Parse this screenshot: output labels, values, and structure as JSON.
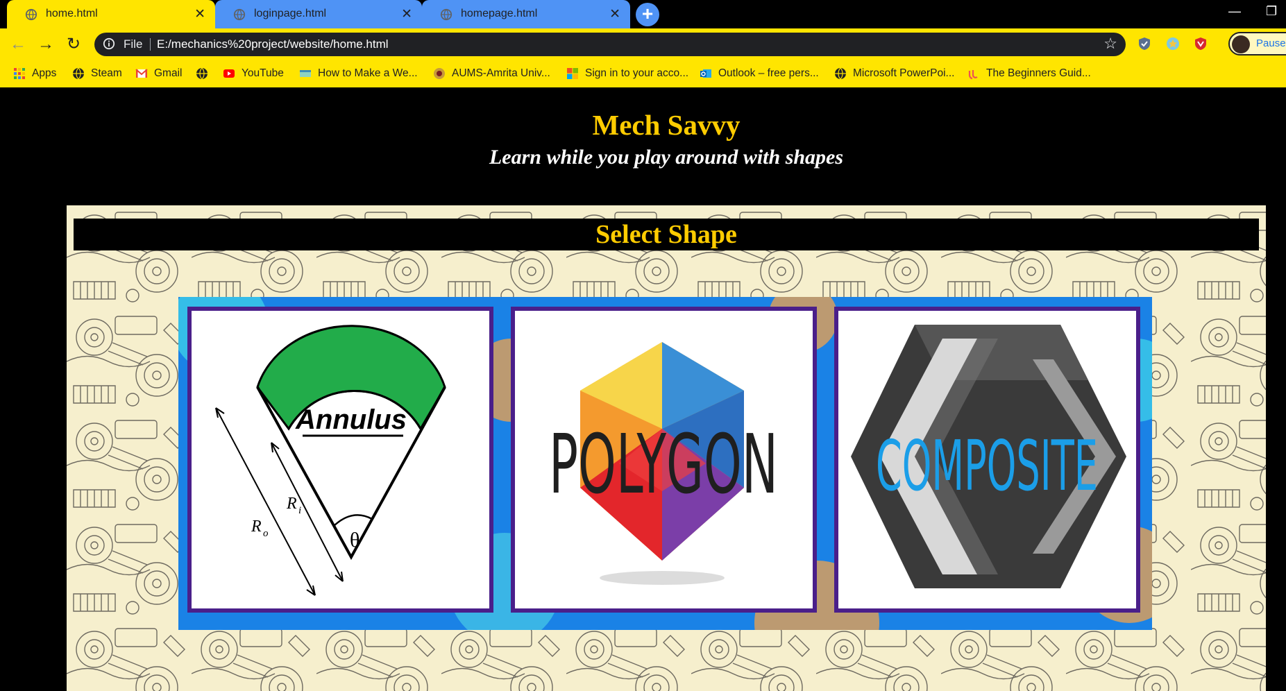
{
  "browser": {
    "tabs": [
      {
        "label": "home.html",
        "active": true
      },
      {
        "label": "loginpage.html",
        "active": false
      },
      {
        "label": "homepage.html",
        "active": false
      }
    ],
    "address": {
      "scheme_label": "File",
      "url": "E:/mechanics%20project/website/home.html"
    },
    "profile_label": "Paused",
    "bookmarks": [
      {
        "label": "Apps",
        "icon": "apps-grid-icon"
      },
      {
        "label": "Steam",
        "icon": "globe-icon"
      },
      {
        "label": "Gmail",
        "icon": "gmail-icon"
      },
      {
        "label": "",
        "icon": "globe-icon"
      },
      {
        "label": "YouTube",
        "icon": "youtube-icon"
      },
      {
        "label": "How to Make a We...",
        "icon": "bookmark-site-icon"
      },
      {
        "label": "AUMS-Amrita Univ...",
        "icon": "amrita-icon"
      },
      {
        "label": "Sign in to your acco...",
        "icon": "microsoft-icon"
      },
      {
        "label": "Outlook – free pers...",
        "icon": "outlook-icon"
      },
      {
        "label": "Microsoft PowerPoi...",
        "icon": "globe-icon"
      },
      {
        "label": "The Beginners Guid...",
        "icon": "udemy-icon"
      }
    ]
  },
  "page": {
    "title": "Mech Savvy",
    "tagline": "Learn while you play around with shapes",
    "section_heading": "Select Shape",
    "shapes": [
      {
        "name": "Annulus",
        "label": "Annulus",
        "dim_outer": "R",
        "dim_outer_sub": "o",
        "dim_inner": "R",
        "dim_inner_sub": "i",
        "angle": "θ"
      },
      {
        "name": "Polygon",
        "label": "POLYGON"
      },
      {
        "name": "Composite",
        "label": "COMPOSITE"
      }
    ]
  },
  "colors": {
    "tab_active": "#ffe500",
    "tab_inactive": "#4f93f5",
    "title": "#ffcc00",
    "card_border": "#4a1f8a",
    "annulus_fill": "#22ac4a",
    "composite_text": "#1b9ee8"
  }
}
